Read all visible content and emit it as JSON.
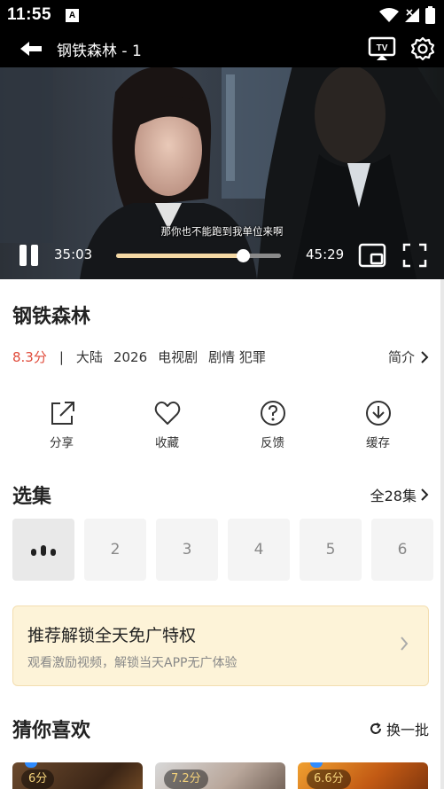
{
  "status_bar": {
    "time": "11:55",
    "app_badge": "A",
    "icons": [
      "wifi-icon",
      "signal-icon",
      "battery-icon"
    ]
  },
  "player": {
    "title": "钢铁森林 - 1",
    "subtitle": "那你也不能跑到我单位来啊",
    "current_time": "35:03",
    "total_time": "45:29",
    "progress": 0.77,
    "icons": [
      "back-arrow-icon",
      "tv-cast-icon",
      "gear-icon",
      "pause-icon",
      "pip-icon",
      "fullscreen-icon"
    ]
  },
  "show": {
    "title": "钢铁森林",
    "rating": "8.3分",
    "separator": "|",
    "region": "大陆",
    "year": "2026",
    "category": "电视剧",
    "genres": "剧情 犯罪",
    "intro_label": "简介"
  },
  "actions": [
    {
      "label": "分享",
      "icon": "share-icon"
    },
    {
      "label": "收藏",
      "icon": "heart-icon"
    },
    {
      "label": "反馈",
      "icon": "question-icon"
    },
    {
      "label": "缓存",
      "icon": "download-icon"
    }
  ],
  "episodes": {
    "title": "选集",
    "all_label": "全28集",
    "items": [
      "playing",
      "2",
      "3",
      "4",
      "5",
      "6"
    ]
  },
  "promo": {
    "title": "推荐解锁全天免广特权",
    "subtitle": "观看激励视频，解锁当天APP无广体验"
  },
  "recommend": {
    "title": "猜你喜欢",
    "refresh_label": "换一批",
    "cards": [
      {
        "score": "6分"
      },
      {
        "score": "7.2分"
      },
      {
        "score": "6.6分"
      }
    ]
  },
  "colors": {
    "rating": "#e04a3a",
    "progress": "#f5d9a5",
    "promo_bg": "#fdf3d8",
    "score": "#f4d27a"
  }
}
